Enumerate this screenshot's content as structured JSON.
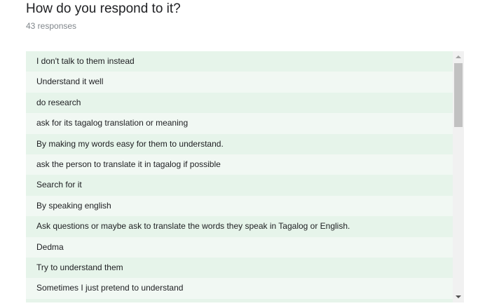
{
  "question": {
    "title": "How do you respond to it?",
    "response_count": "43 responses"
  },
  "responses": [
    "I don't talk to them instead",
    "Understand it well",
    "do research",
    "ask for its tagalog translation or meaning",
    "By making my words easy for them to understand.",
    "ask the person to translate it in tagalog if possible",
    "Search for it",
    "By speaking english",
    "Ask questions or maybe ask to translate the words they speak in Tagalog or English.",
    "Dedma",
    "Try to understand them",
    "Sometimes I just pretend to understand",
    ""
  ],
  "scrollbar": {
    "up_icon": "arrow-up-icon",
    "down_icon": "arrow-down-icon"
  },
  "colors": {
    "row_odd": "#e6f4ea",
    "row_even": "#f1f8f3",
    "title": "#202124",
    "muted": "#80868b"
  }
}
